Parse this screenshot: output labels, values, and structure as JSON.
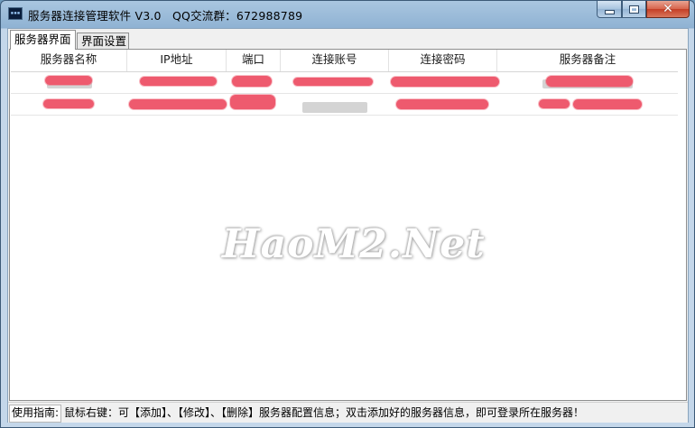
{
  "window": {
    "title": "服务器连接管理软件 V3.0",
    "group_info": "QQ交流群：672988789",
    "icon": "app-terminal-icon",
    "close_glyph": "✕"
  },
  "tabs": [
    {
      "label": "服务器界面",
      "active": true
    },
    {
      "label": "界面设置",
      "active": false
    }
  ],
  "table": {
    "columns": [
      "服务器名称",
      "IP地址",
      "端口",
      "连接账号",
      "连接密码",
      "服务器备注"
    ],
    "rows_note": "cell values redacted in screenshot"
  },
  "watermark": "HaoM2.Net",
  "status": {
    "label": "使用指南:",
    "text": "鼠标右键：可【添加】、【修改】、【删除】服务器配置信息；双击添加好的服务器信息，即可登录所在服务器！"
  },
  "colors": {
    "redaction": "#ee5a6e",
    "titlebar": "#8fb2d3",
    "close_button": "#c43e26"
  }
}
